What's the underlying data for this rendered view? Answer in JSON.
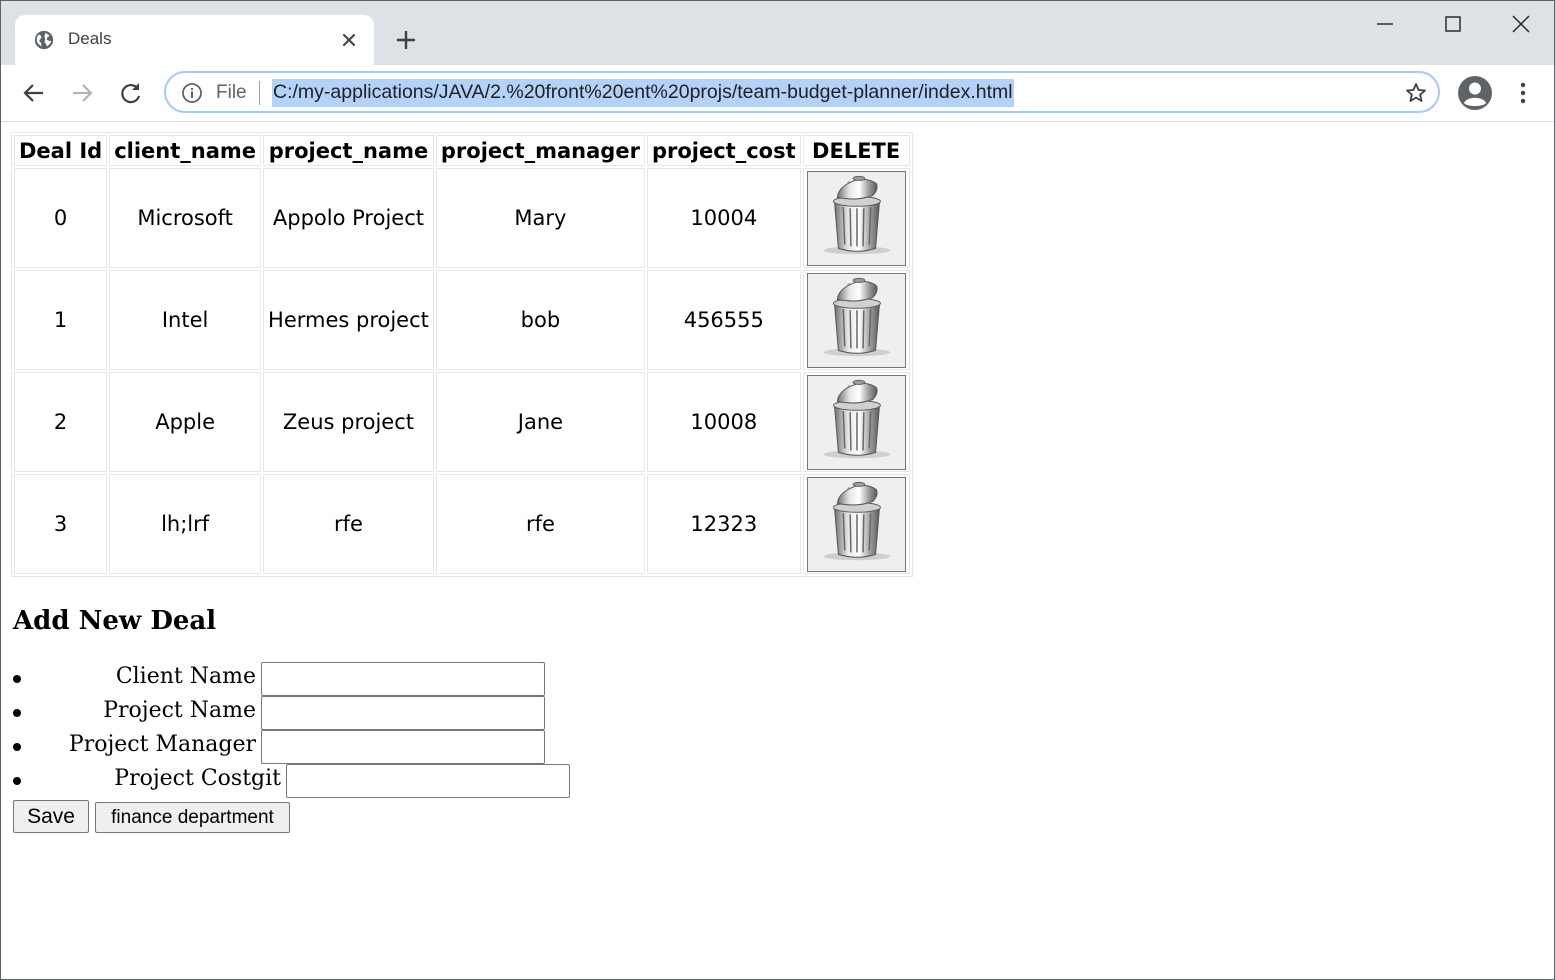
{
  "browser": {
    "tab_title": "Deals",
    "file_label": "File",
    "url": "C:/my-applications/JAVA/2.%20front%20ent%20projs/team-budget-planner/index.html"
  },
  "table": {
    "headers": [
      "Deal Id",
      "client_name",
      "project_name",
      "project_manager",
      "project_cost",
      "DELETE"
    ],
    "rows": [
      {
        "id": "0",
        "client": "Microsoft",
        "project": "Appolo Project",
        "manager": "Mary",
        "cost": "10004"
      },
      {
        "id": "1",
        "client": "Intel",
        "project": "Hermes project",
        "manager": "bob",
        "cost": "456555"
      },
      {
        "id": "2",
        "client": "Apple",
        "project": "Zeus project",
        "manager": "Jane",
        "cost": "10008"
      },
      {
        "id": "3",
        "client": "lh;lrf",
        "project": "rfe",
        "manager": "rfe",
        "cost": "12323"
      }
    ]
  },
  "form": {
    "title": "Add New Deal",
    "fields": [
      {
        "label": "Client Name",
        "value": ""
      },
      {
        "label": "Project Name",
        "value": ""
      },
      {
        "label": "Project Manager",
        "value": ""
      },
      {
        "label": "Project Costgit",
        "value": ""
      }
    ],
    "save_label": "Save",
    "finance_label": "finance department"
  },
  "icons": {
    "tab_favicon": "globe-icon",
    "tab_close": "close-icon",
    "new_tab": "plus-icon",
    "minimize": "minimize-icon",
    "maximize": "maximize-icon",
    "close_window": "close-icon",
    "back": "arrow-left-icon",
    "forward": "arrow-right-icon",
    "reload": "reload-icon",
    "info": "info-icon",
    "bookmark": "star-icon",
    "profile": "account-icon",
    "menu": "kebab-menu-icon",
    "delete": "trash-can-icon"
  }
}
